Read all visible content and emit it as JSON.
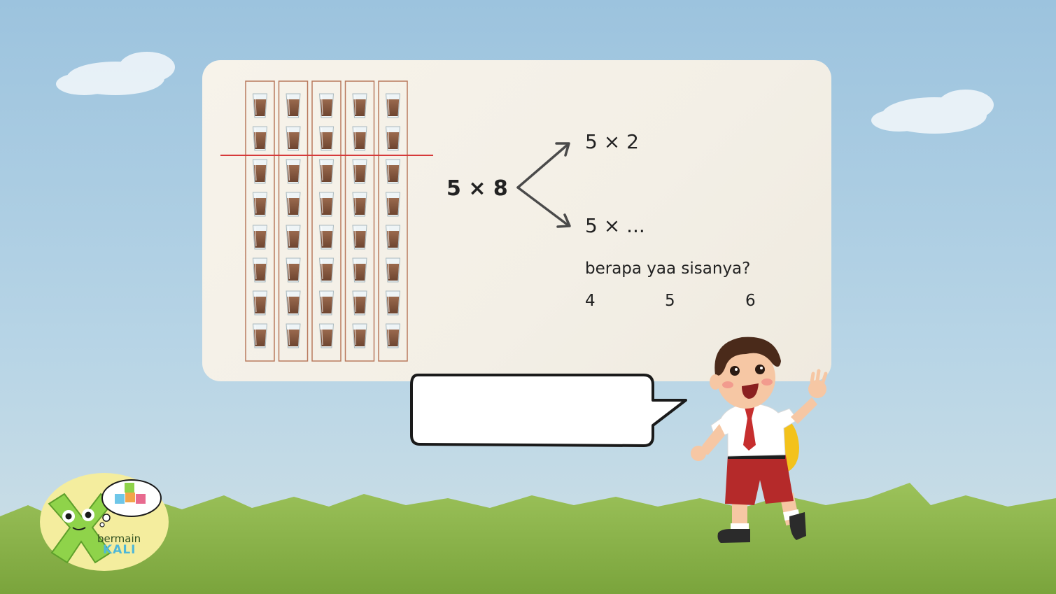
{
  "problem": {
    "expression": "5 × 8",
    "split_top": "5 × 2",
    "split_bottom": "5 × ...",
    "question": "berapa yaa sisanya?",
    "options": [
      "4",
      "5",
      "6"
    ]
  },
  "grid": {
    "columns": 5,
    "rows": 8,
    "split_after_row": 2
  },
  "speech_bubble": {
    "text": ""
  },
  "logo": {
    "line1": "bermain",
    "line2": "KALI"
  },
  "colors": {
    "sky": "#a9cbe0",
    "grass": "#8fb54a",
    "card": "#f5f1e8",
    "split_line": "#d63a3a",
    "column_border": "#b97a5e",
    "logo_badge": "#f4ed9e",
    "logo_x": "#8fd34a"
  },
  "icons": [
    "glass-icon",
    "arrow-icon",
    "boy-character",
    "thought-bubble-icon"
  ]
}
